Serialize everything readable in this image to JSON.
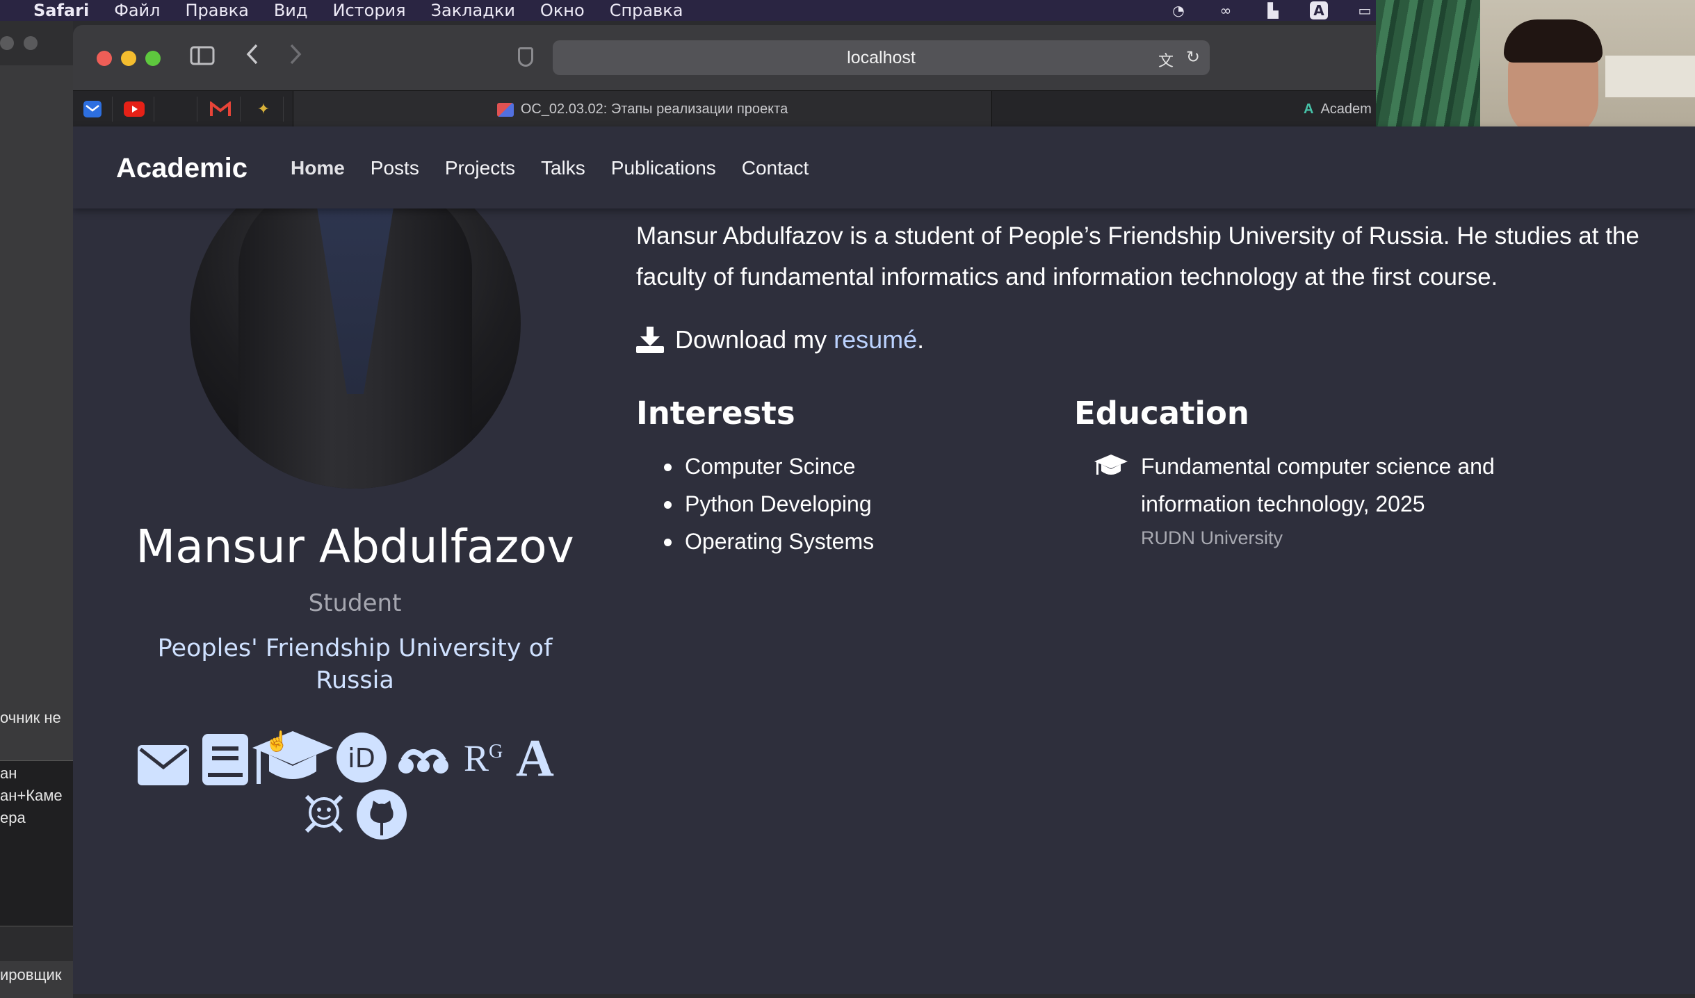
{
  "menubar": {
    "app": "Safari",
    "items": [
      "Файл",
      "Правка",
      "Вид",
      "История",
      "Закладки",
      "Окно",
      "Справка"
    ]
  },
  "background_window": {
    "texts": [
      "очник не",
      "ан",
      "ан+Каме",
      "ера",
      "ировщик"
    ]
  },
  "browser": {
    "url": "localhost",
    "tabs": {
      "active": "ОС_02.03.02: Этапы реализации проекта",
      "second": "Academ"
    }
  },
  "site": {
    "brand": "Academic",
    "nav": [
      "Home",
      "Posts",
      "Projects",
      "Talks",
      "Publications",
      "Contact"
    ]
  },
  "profile": {
    "name": "Mansur Abdulfazov",
    "role": "Student",
    "organization": "Peoples' Friendship University of Russia"
  },
  "about": {
    "bio": "Mansur Abdulfazov is a student of People’s Friendship University of Russia. He studies at the faculty of fundamental informatics and information technology at the first course.",
    "download_prefix": "Download my ",
    "download_link": "resumé",
    "download_suffix": "."
  },
  "interests": {
    "heading": "Interests",
    "items": [
      "Computer Scince",
      "Python Developing",
      "Operating Systems"
    ]
  },
  "education": {
    "heading": "Education",
    "course": "Fundamental computer science and information technology, 2025",
    "institution": "RUDN University"
  },
  "social_icons": [
    "envelope-icon",
    "book-icon",
    "graduation-cap-icon",
    "orcid-icon",
    "mendeley-icon",
    "researchgate-icon",
    "academia-icon",
    "skull-crossbones-icon",
    "github-icon"
  ],
  "colors": {
    "page_bg": "#2e2f3c",
    "link": "#bcd3ff",
    "muted": "#a6a7b0"
  }
}
